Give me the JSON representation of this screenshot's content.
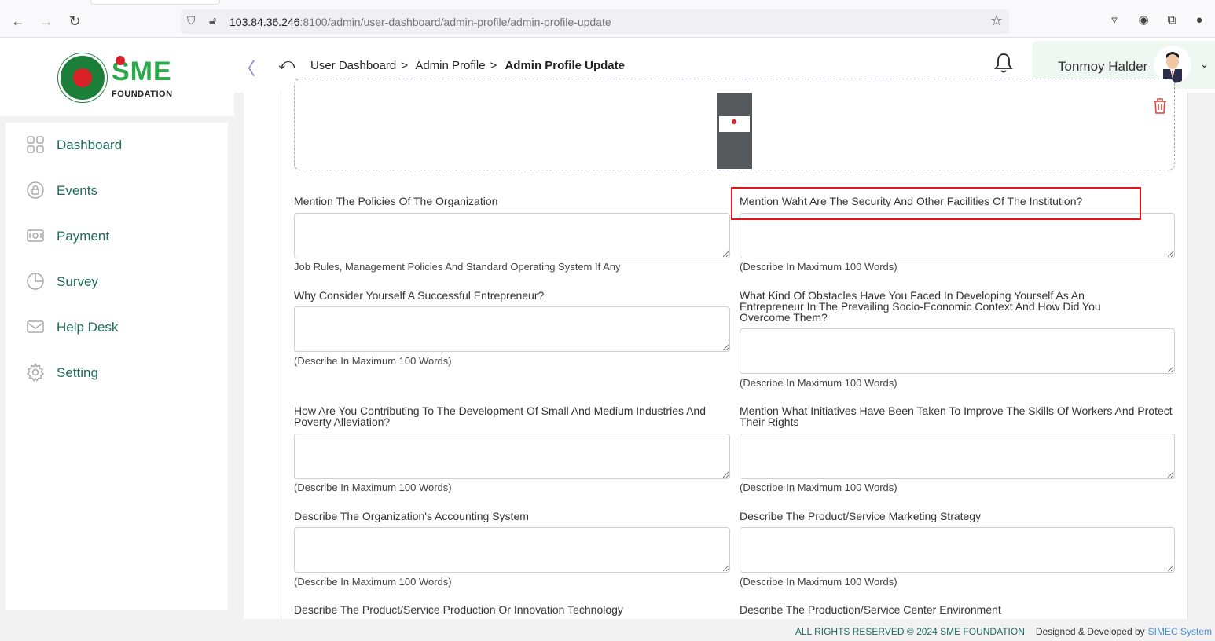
{
  "browser": {
    "url_host": "103.84.36.246",
    "url_rest": ":8100/admin/user-dashboard/admin-profile/admin-profile-update"
  },
  "header": {
    "logo_text": "SME",
    "logo_subtext": "FOUNDATION",
    "breadcrumb": [
      "User Dashboard",
      "Admin Profile",
      "Admin Profile Update"
    ],
    "user_name": "Tonmoy Halder"
  },
  "sidebar": {
    "items": [
      {
        "label": "Dashboard",
        "icon": "grid-icon"
      },
      {
        "label": "Events",
        "icon": "lock-icon"
      },
      {
        "label": "Payment",
        "icon": "money-icon"
      },
      {
        "label": "Survey",
        "icon": "pie-chart-icon"
      },
      {
        "label": "Help Desk",
        "icon": "mail-icon"
      },
      {
        "label": "Setting",
        "icon": "gear-icon"
      }
    ]
  },
  "form": {
    "questions": [
      {
        "label": "Mention The Policies Of The Organization",
        "hint": "Job Rules, Management Policies And Standard Operating System If Any"
      },
      {
        "label": "Mention Waht Are The Security And Other Facilities Of The Institution?",
        "hint": "(Describe In Maximum 100 Words)"
      },
      {
        "label": "Why Consider Yourself A Successful Entrepreneur?",
        "hint": "(Describe In Maximum 100 Words)"
      },
      {
        "label": "What Kind Of Obstacles Have You Faced In Developing Yourself As An Entrepreneur In The Prevailing Socio-Economic Context And How Did You Overcome Them?",
        "hint": "(Describe In Maximum 100 Words)"
      },
      {
        "label": "How Are You Contributing To The Development Of Small And Medium Industries And Poverty Alleviation?",
        "hint": "(Describe In Maximum 100 Words)"
      },
      {
        "label": "Mention What Initiatives Have Been Taken To Improve The Skills Of Workers And Protect Their Rights",
        "hint": "(Describe In Maximum 100 Words)"
      },
      {
        "label": "Describe The Organization's Accounting System",
        "hint": "(Describe In Maximum 100 Words)"
      },
      {
        "label": "Describe The Product/Service Marketing Strategy",
        "hint": "(Describe In Maximum 100 Words)"
      },
      {
        "label": "Describe The Product/Service Production Or Innovation Technology",
        "hint": ""
      },
      {
        "label": "Describe The Production/Service Center Environment",
        "hint": ""
      }
    ]
  },
  "footer": {
    "rights": "ALL RIGHTS RESERVED © 2024 SME FOUNDATION",
    "designed_by": "Designed & Developed by",
    "company": "SIMEC System"
  },
  "colors": {
    "accent": "#1e6b5d",
    "highlight": "#e3151a",
    "brand_green": "#2ba84a"
  }
}
